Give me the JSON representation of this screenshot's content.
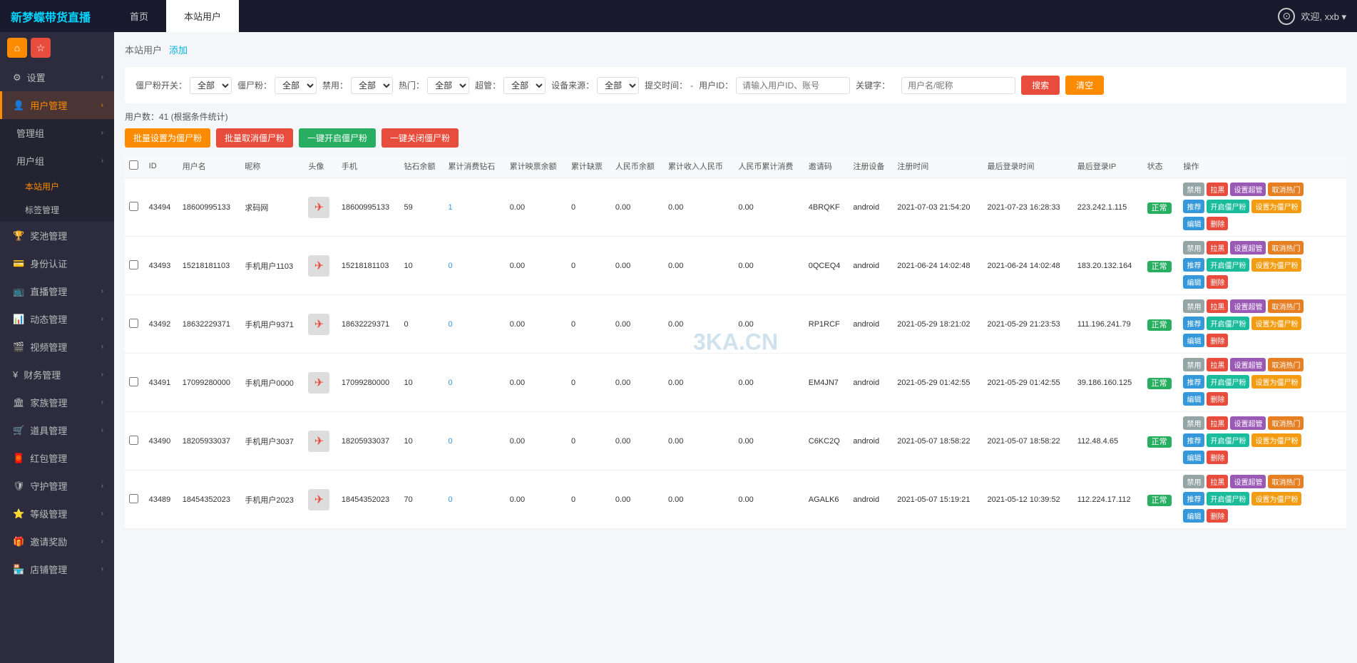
{
  "brand": "新梦蝶带货直播",
  "topNav": {
    "tabs": [
      {
        "label": "首页",
        "active": false
      },
      {
        "label": "本站用户",
        "active": true
      }
    ],
    "userGreeting": "欢迎, xxb ▾",
    "userIconSymbol": "⊙"
  },
  "sidebar": {
    "topIcons": [
      {
        "name": "home-icon",
        "symbol": "⌂",
        "class": "orange"
      },
      {
        "name": "bookmark-icon",
        "symbol": "☆",
        "class": "red"
      }
    ],
    "items": [
      {
        "id": "settings",
        "label": "设置",
        "icon": "⚙",
        "active": false,
        "hasChevron": true
      },
      {
        "id": "user-management",
        "label": "用户管理",
        "icon": "👤",
        "active": true,
        "hasChevron": true
      },
      {
        "id": "admin-group",
        "label": "管理组",
        "icon": "",
        "active": false,
        "hasChevron": true,
        "indent": true
      },
      {
        "id": "user-group",
        "label": "用户组",
        "icon": "",
        "active": false,
        "hasChevron": true,
        "indent": true
      },
      {
        "id": "site-users",
        "label": "本站用户",
        "active": true,
        "isSubItem": true
      },
      {
        "id": "tag-management",
        "label": "标签管理",
        "active": false,
        "isSubItem": true
      },
      {
        "id": "prize-management",
        "label": "奖池管理",
        "icon": "🏆",
        "active": false,
        "hasChevron": false
      },
      {
        "id": "identity-auth",
        "label": "身份认证",
        "icon": "💳",
        "active": false,
        "hasChevron": false
      },
      {
        "id": "live-management",
        "label": "直播管理",
        "icon": "📺",
        "active": false,
        "hasChevron": true
      },
      {
        "id": "dynamic-management",
        "label": "动态管理",
        "icon": "📊",
        "active": false,
        "hasChevron": true
      },
      {
        "id": "video-management",
        "label": "视频管理",
        "icon": "🎬",
        "active": false,
        "hasChevron": true
      },
      {
        "id": "finance-management",
        "label": "财务管理",
        "icon": "¥",
        "active": false,
        "hasChevron": true
      },
      {
        "id": "family-management",
        "label": "家族管理",
        "icon": "🏛",
        "active": false,
        "hasChevron": true
      },
      {
        "id": "props-management",
        "label": "道具管理",
        "icon": "🛒",
        "active": false,
        "hasChevron": true
      },
      {
        "id": "redpack-management",
        "label": "红包管理",
        "icon": "🧧",
        "active": false,
        "hasChevron": false
      },
      {
        "id": "guard-management",
        "label": "守护管理",
        "icon": "🛡",
        "active": false,
        "hasChevron": true
      },
      {
        "id": "level-management",
        "label": "等级管理",
        "icon": "⭐",
        "active": false,
        "hasChevron": true
      },
      {
        "id": "invite-reward",
        "label": "邀请奖励",
        "icon": "🎁",
        "active": false,
        "hasChevron": true
      },
      {
        "id": "shop-management",
        "label": "店铺管理",
        "icon": "🏪",
        "active": false,
        "hasChevron": true
      }
    ]
  },
  "breadcrumb": {
    "current": "本站用户",
    "addLabel": "添加"
  },
  "filters": {
    "fansSwitch": {
      "label": "僵尸粉开关：",
      "options": [
        "全部"
      ],
      "selected": "全部"
    },
    "fansCount": {
      "label": "僵尸粉：",
      "options": [
        "全部"
      ],
      "selected": "全部"
    },
    "ban": {
      "label": "禁用：",
      "options": [
        "全部"
      ],
      "selected": "全部"
    },
    "hot": {
      "label": "热门：",
      "options": [
        "全部"
      ],
      "selected": "全部"
    },
    "superAdmin": {
      "label": "超管：",
      "options": [
        "全部"
      ],
      "selected": "全部"
    },
    "deviceSource": {
      "label": "设备来源：",
      "options": [
        "全部"
      ],
      "selected": "全部"
    },
    "submitTime": {
      "label": "提交时间：",
      "value": "-"
    },
    "userId": {
      "label": "用户ID：",
      "placeholder": "请输入用户ID、账号"
    },
    "keyword": {
      "label": "关键字："
    },
    "usernameInput": {
      "placeholder": "用户名/昵称"
    },
    "searchBtn": "搜索",
    "clearBtn": "清空"
  },
  "countInfo": "用户数：41 (根据条件统计)",
  "bulkActions": [
    {
      "label": "批量设置为僵尸粉",
      "class": "orange"
    },
    {
      "label": "批量取消僵尸粉",
      "class": "red"
    },
    {
      "label": "一键开启僵尸粉",
      "class": "green"
    },
    {
      "label": "一键关闭僵尸粉",
      "class": "red"
    }
  ],
  "tableHeaders": [
    "",
    "ID",
    "用户名",
    "昵称",
    "头像",
    "手机",
    "钻石余额",
    "累计消费钻石",
    "累计映票余额",
    "累计缺票",
    "人民币余额",
    "累计收入人民币",
    "人民币累计消费",
    "邀请码",
    "注册设备",
    "注册时间",
    "最后登录时间",
    "最后登录IP",
    "状态",
    "操作"
  ],
  "tableRows": [
    {
      "id": "43494",
      "username": "18600995133",
      "nickname": "求码网",
      "avatar": "✈",
      "phone": "18600995133",
      "diamonds": "59",
      "totalDiamonds": "1",
      "ticketsBalance": "0.00",
      "missedTickets": "0",
      "rmbBalance": "0.00",
      "totalRmb": "0.00",
      "totalRmbSpend": "0.00",
      "inviteCode": "4BRQKF",
      "device": "android",
      "registerTime": "2021-07-03 21:54:20",
      "lastLoginTime": "2021-07-23 16:28:33",
      "lastLoginIp": "223.242.1.115",
      "status": "正常"
    },
    {
      "id": "43493",
      "username": "15218181103",
      "nickname": "手机用户1103",
      "avatar": "✈",
      "phone": "15218181103",
      "diamonds": "10",
      "totalDiamonds": "0",
      "ticketsBalance": "0.00",
      "missedTickets": "0",
      "rmbBalance": "0.00",
      "totalRmb": "0.00",
      "totalRmbSpend": "0.00",
      "inviteCode": "0QCEQ4",
      "device": "android",
      "registerTime": "2021-06-24 14:02:48",
      "lastLoginTime": "2021-06-24 14:02:48",
      "lastLoginIp": "183.20.132.164",
      "status": "正常"
    },
    {
      "id": "43492",
      "username": "18632229371",
      "nickname": "手机用户9371",
      "avatar": "✈",
      "phone": "18632229371",
      "diamonds": "0",
      "totalDiamonds": "0",
      "ticketsBalance": "0.00",
      "missedTickets": "0",
      "rmbBalance": "0.00",
      "totalRmb": "0.00",
      "totalRmbSpend": "0.00",
      "inviteCode": "RP1RCF",
      "device": "android",
      "registerTime": "2021-05-29 18:21:02",
      "lastLoginTime": "2021-05-29 21:23:53",
      "lastLoginIp": "111.196.241.79",
      "status": "正常"
    },
    {
      "id": "43491",
      "username": "17099280000",
      "nickname": "手机用户0000",
      "avatar": "✈",
      "phone": "17099280000",
      "diamonds": "10",
      "totalDiamonds": "0",
      "ticketsBalance": "0.00",
      "missedTickets": "0",
      "rmbBalance": "0.00",
      "totalRmb": "0.00",
      "totalRmbSpend": "0.00",
      "inviteCode": "EM4JN7",
      "device": "android",
      "registerTime": "2021-05-29 01:42:55",
      "lastLoginTime": "2021-05-29 01:42:55",
      "lastLoginIp": "39.186.160.125",
      "status": "正常"
    },
    {
      "id": "43490",
      "username": "18205933037",
      "nickname": "手机用户3037",
      "avatar": "✈",
      "phone": "18205933037",
      "diamonds": "10",
      "totalDiamonds": "0",
      "ticketsBalance": "0.00",
      "missedTickets": "0",
      "rmbBalance": "0.00",
      "totalRmb": "0.00",
      "totalRmbSpend": "0.00",
      "inviteCode": "C6KC2Q",
      "device": "android",
      "registerTime": "2021-05-07 18:58:22",
      "lastLoginTime": "2021-05-07 18:58:22",
      "lastLoginIp": "112.48.4.65",
      "status": "正常"
    },
    {
      "id": "43489",
      "username": "18454352023",
      "nickname": "手机用户2023",
      "avatar": "✈",
      "phone": "18454352023",
      "diamonds": "70",
      "totalDiamonds": "0",
      "ticketsBalance": "0.00",
      "missedTickets": "0",
      "rmbBalance": "0.00",
      "totalRmb": "0.00",
      "totalRmbSpend": "0.00",
      "inviteCode": "AGALK6",
      "device": "android",
      "registerTime": "2021-05-07 15:19:21",
      "lastLoginTime": "2021-05-12 10:39:52",
      "lastLoginIp": "112.224.17.112",
      "status": "正常"
    }
  ],
  "watermark": "3KA.CN",
  "actionLabels": {
    "disable": "禁用",
    "pull": "拉黑",
    "setSuper": "设置超管",
    "cancelHot": "取消热门",
    "recommend": "推荐",
    "openFans": "开启僵尸粉",
    "setFans": "设置为僵尸粉",
    "edit": "编辑",
    "delete": "删除"
  }
}
